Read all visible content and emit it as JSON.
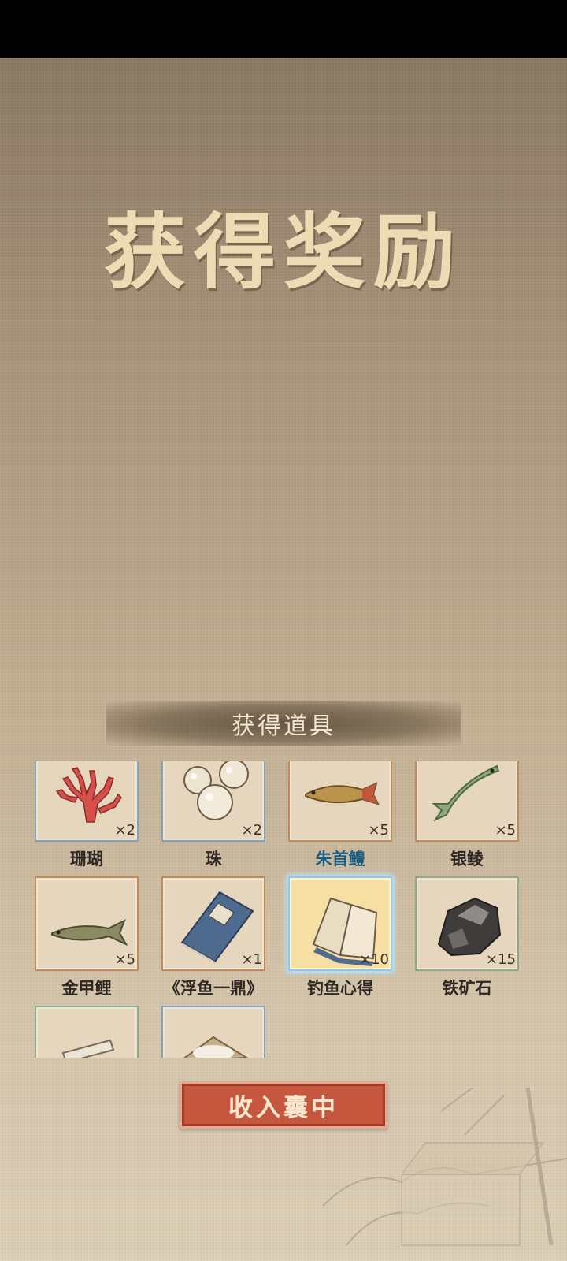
{
  "title": "获得奖励",
  "section_title": "获得道具",
  "items": [
    {
      "name": "珊瑚",
      "qty": "×2",
      "icon": "coral-icon",
      "rarity": "blue"
    },
    {
      "name": "珠",
      "qty": "×2",
      "icon": "pearls-icon",
      "rarity": "blue"
    },
    {
      "name": "朱首鳢",
      "qty": "×5",
      "icon": "arowana-fish-icon",
      "rarity": "orange"
    },
    {
      "name": "银鲮",
      "qty": "×5",
      "icon": "carp-fish-icon",
      "rarity": "orange"
    },
    {
      "name": "金甲鲤",
      "qty": "×5",
      "icon": "grass-carp-icon",
      "rarity": "orange"
    },
    {
      "name": "《浮鱼一鼎》",
      "qty": "×1",
      "icon": "book-icon",
      "rarity": "orange"
    },
    {
      "name": "钓鱼心得",
      "qty": "×10",
      "icon": "open-book-icon",
      "rarity": "selected"
    },
    {
      "name": "铁矿石",
      "qty": "×15",
      "icon": "iron-ore-icon",
      "rarity": "green"
    },
    {
      "name": "",
      "qty": "",
      "icon": "scroll-icon",
      "rarity": "green"
    },
    {
      "name": "",
      "qty": "",
      "icon": "rice-icon",
      "rarity": "blue"
    }
  ],
  "collect_button": "收入囊中",
  "colors": {
    "button": "#c5573e",
    "title": "#ecdcb4",
    "selected_glow": "#8fc7ec"
  }
}
